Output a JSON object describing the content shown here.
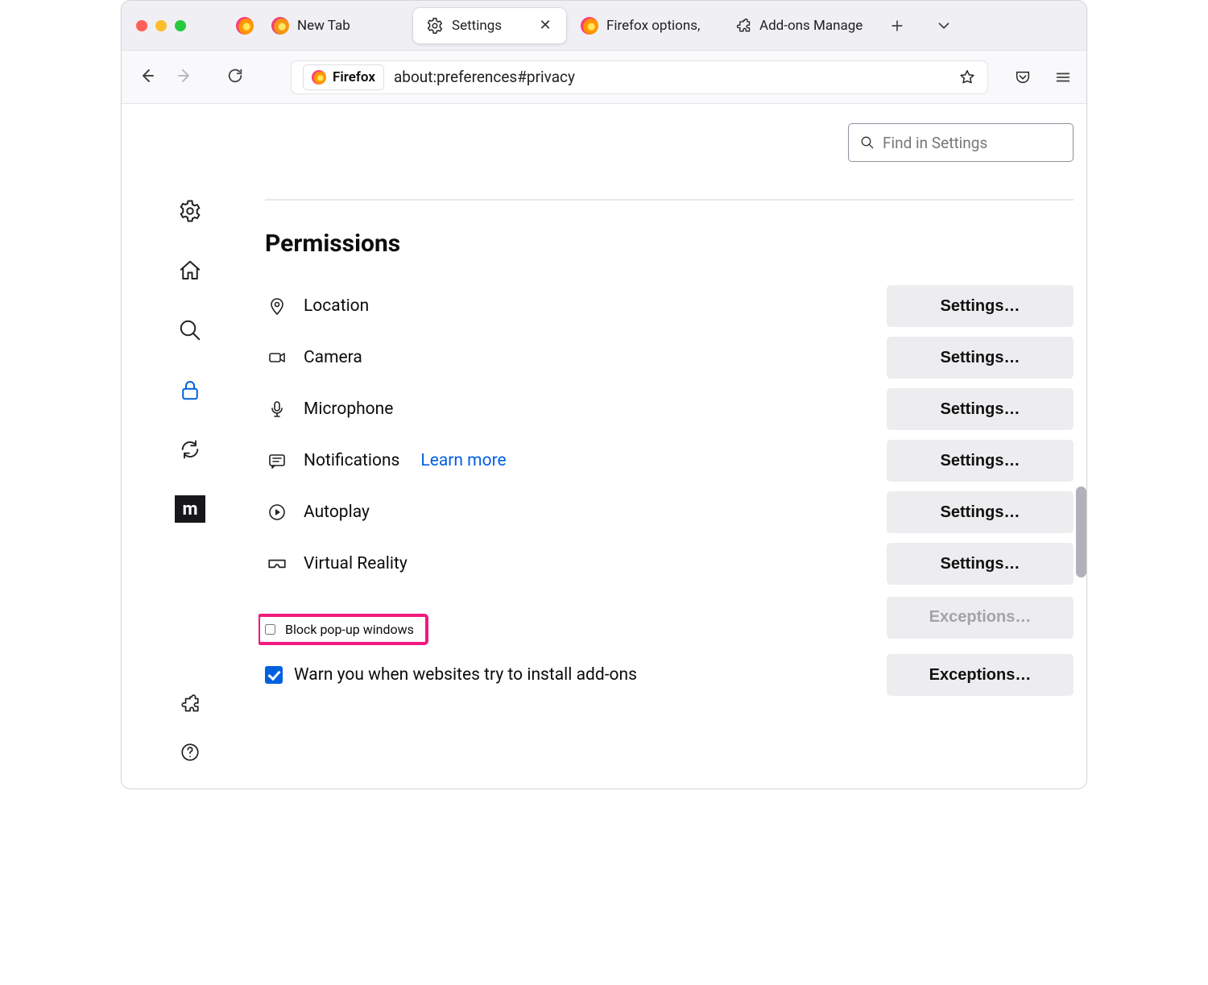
{
  "tabs": {
    "new": "New Tab",
    "settings": "Settings",
    "options": "Firefox options,",
    "addons": "Add-ons Manage"
  },
  "urlbar": {
    "identity": "Firefox",
    "url": "about:preferences#privacy"
  },
  "search": {
    "placeholder": "Find in Settings"
  },
  "main": {
    "section_title": "Permissions",
    "perms": {
      "location": "Location",
      "camera": "Camera",
      "microphone": "Microphone",
      "notifications": "Notifications",
      "autoplay": "Autoplay",
      "vr": "Virtual Reality"
    },
    "learn_more": "Learn more",
    "settings_btn": "Settings…",
    "exceptions_btn": "Exceptions…",
    "block_popups": "Block pop-up windows",
    "warn_addons": "Warn you when websites try to install add-ons"
  },
  "sidebar_mozilla": "m"
}
